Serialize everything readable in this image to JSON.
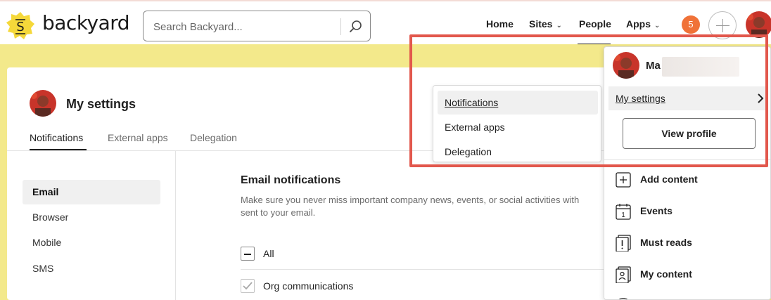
{
  "brand": {
    "name": "backyard",
    "logo_icon": "backyard-logo-icon",
    "logo_letter": "S",
    "logo_color": "#f5d83a"
  },
  "search": {
    "placeholder": "Search Backyard..."
  },
  "nav": {
    "items": [
      {
        "label": "Home",
        "has_menu": false
      },
      {
        "label": "Sites",
        "has_menu": true
      },
      {
        "label": "People",
        "has_menu": false,
        "active": true
      },
      {
        "label": "Apps",
        "has_menu": true
      }
    ]
  },
  "notifications_badge": "5",
  "settings": {
    "title": "My settings",
    "tabs": [
      {
        "label": "Notifications",
        "active": true
      },
      {
        "label": "External apps",
        "active": false
      },
      {
        "label": "Delegation",
        "active": false
      }
    ],
    "sidebar": [
      {
        "label": "Email",
        "active": true
      },
      {
        "label": "Browser",
        "active": false
      },
      {
        "label": "Mobile",
        "active": false
      },
      {
        "label": "SMS",
        "active": false
      }
    ],
    "section_title": "Email notifications",
    "section_desc_line1": "Make sure you never miss important company news, events, or social activities with",
    "section_desc_line2": "sent to your email.",
    "options": [
      {
        "label": "All",
        "state": "indeterminate"
      },
      {
        "label": "Org communications",
        "state": "checked"
      }
    ]
  },
  "submenu": {
    "items": [
      {
        "label": "Notifications",
        "hover": true
      },
      {
        "label": "External apps",
        "hover": false
      },
      {
        "label": "Delegation",
        "hover": false
      }
    ]
  },
  "profile_menu": {
    "name_visible": "Ma",
    "my_settings_label": "My settings",
    "view_profile_label": "View profile",
    "items": [
      {
        "label": "Add content",
        "icon": "plus-square-icon"
      },
      {
        "label": "Events",
        "icon": "calendar-icon",
        "icon_text": "1"
      },
      {
        "label": "Must reads",
        "icon": "exclamation-doc-icon"
      },
      {
        "label": "My content",
        "icon": "person-doc-icon"
      }
    ]
  },
  "colors": {
    "accent_yellow": "#f3e98b",
    "badge_orange": "#f07238",
    "highlight_red": "#e2574c"
  }
}
